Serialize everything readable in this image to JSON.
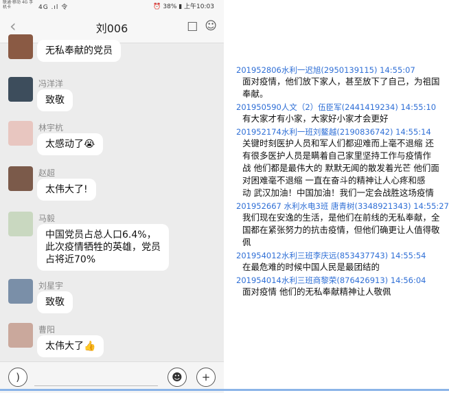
{
  "status_bar": {
    "carrier": "联通·移动 4G 手机卡",
    "signal": "4G .ıl 令",
    "right": "⏰ 38% ▮ 上午10:03"
  },
  "header": {
    "back_icon": "back-chevron-icon",
    "title": "刘006",
    "icons": [
      "notebook-icon",
      "group-members-icon"
    ]
  },
  "chat": {
    "messages": [
      {
        "sender": "",
        "text": "无私奉献的党员",
        "avatar_color": "#8a5a44"
      },
      {
        "sender": "冯洋洋",
        "text": "致敬",
        "avatar_color": "#3d4d5c"
      },
      {
        "sender": "林宇杭",
        "text": "太感动了😭",
        "avatar_color": "#e8c6c0"
      },
      {
        "sender": "赵超",
        "text": "太伟大了!",
        "avatar_color": "#7b5a4a"
      },
      {
        "sender": "马毅",
        "text": "中国党员占总人口6.4%，此次疫情牺牲的英雄，党员占将近70%",
        "lines": [
          "中国党员占总人口6.4%，",
          "此次疫情牺牲的英雄，党员",
          "占将近70%"
        ],
        "avatar_color": "#c9d8c0"
      },
      {
        "sender": "刘星宇",
        "text": "致敬",
        "avatar_color": "#7a8fa8"
      },
      {
        "sender": "曹阳",
        "text": "太伟大了👍",
        "avatar_color": "#caa89c"
      }
    ]
  },
  "input_bar": {
    "voice_icon": "voice-icon",
    "emoji_icon": "emoji-icon",
    "plus_icon": "plus-icon"
  },
  "group_log": [
    {
      "head": "201952806水利一迟旭(2950139115) 14:55:07",
      "body": [
        "面对疫情，他们放下家人，甚至放下了自己，为祖国",
        "奉献。"
      ]
    },
    {
      "head": "201950590人文（2）伍臣军(2441419234) 14:55:10",
      "body": [
        "有大家才有小家，大家好小家才会更好"
      ]
    },
    {
      "head": "201952174水利一班刘鳌越(2190836742) 14:55:14",
      "body": [
        "关键时刻医护人员和军人们都迎难而上毫不退缩 还",
        "有很多医护人员是瞒着自己家里坚持工作与疫情作",
        "战 他们都是最伟大的 默默无闻的散发着光芒 他们面",
        "对困难毫不退缩 一直在奋斗的精神让人心疼和感",
        "动 武汉加油！中国加油！我们一定会战胜这场疫情"
      ]
    },
    {
      "head": "201952667 水利水电3班  唐青树(3348921343) 14:55:27",
      "body": [
        "我们现在安逸的生活，是他们在前线的无私奉献，全",
        "国都在紧张努力的抗击疫情，但他们确更让人值得敬",
        "佩"
      ]
    },
    {
      "head": "201954012水利三班李庆远(853437743) 14:55:54",
      "body": [
        "在最危难的时候中国人民是最团结的"
      ]
    },
    {
      "head": "201954014水利三班商黎荣(876426913) 14:56:04",
      "body": [
        "面对疫情  他们的无私奉献精神让人敬佩"
      ]
    }
  ]
}
